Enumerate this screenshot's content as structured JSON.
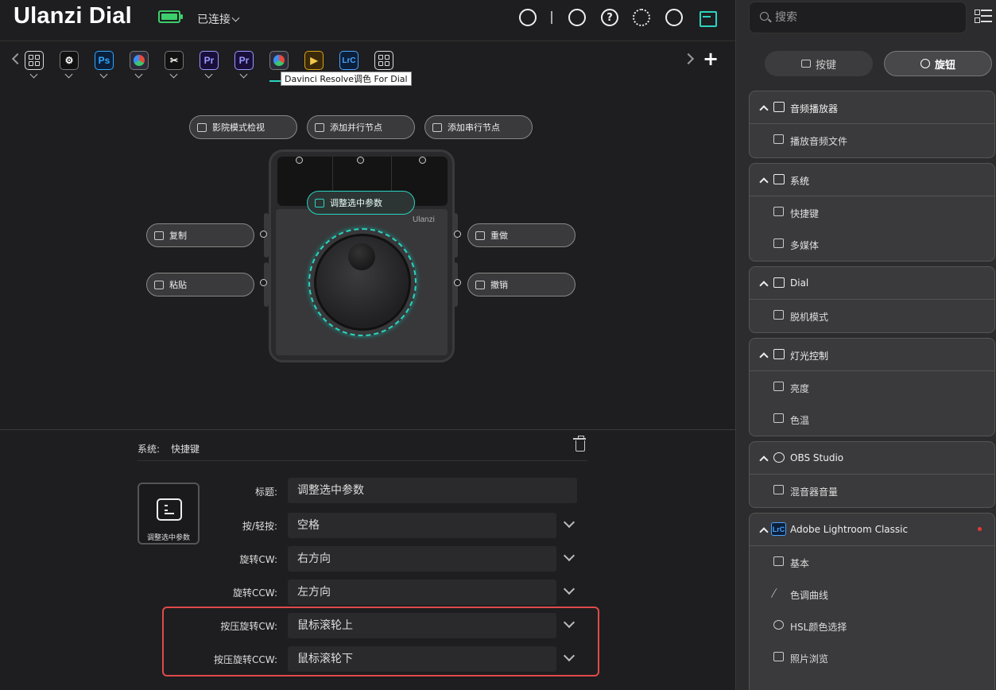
{
  "header": {
    "title": "Ulanzi Dial",
    "connection_status": "已连接",
    "battery_level": 1.0,
    "icons": [
      "u-logo-icon",
      "palette-icon",
      "help-icon",
      "settings-icon",
      "account-icon",
      "store-icon"
    ]
  },
  "toolbar": {
    "profiles": [
      {
        "name": "grid",
        "label": ""
      },
      {
        "name": "settings-app",
        "label": ""
      },
      {
        "name": "photoshop",
        "label": "Ps"
      },
      {
        "name": "davinci-resolve",
        "label": ""
      },
      {
        "name": "capcut",
        "label": ""
      },
      {
        "name": "premiere-pro-1",
        "label": "Pr"
      },
      {
        "name": "premiere-pro-2",
        "label": "Pr"
      },
      {
        "name": "davinci-resolve-active",
        "label": ""
      },
      {
        "name": "final-cut",
        "label": ""
      },
      {
        "name": "lightroom-classic",
        "label": "LrC"
      },
      {
        "name": "grid-2",
        "label": ""
      }
    ],
    "tooltip": "Davinci Resolve调色 For Dial",
    "add_symbol": "+"
  },
  "canvas": {
    "top_buttons": [
      "影院模式检视",
      "添加并行节点",
      "添加串行节点"
    ],
    "center_button": "调整选中参数",
    "left_buttons": [
      "复制",
      "粘贴"
    ],
    "right_buttons": [
      "重做",
      "撤销"
    ],
    "brand": "Ulanzi"
  },
  "properties": {
    "category": "系统:",
    "action": "快捷键",
    "preview_label": "调整选中参数",
    "fields": [
      {
        "label": "标题:",
        "value": "调整选中参数",
        "has_dropdown": false
      },
      {
        "label": "按/轻按:",
        "value": "空格",
        "has_dropdown": true
      },
      {
        "label": "旋转CW:",
        "value": "右方向",
        "has_dropdown": true
      },
      {
        "label": "旋转CCW:",
        "value": "左方向",
        "has_dropdown": true
      },
      {
        "label": "按压旋转CW:",
        "value": "鼠标滚轮上",
        "has_dropdown": true
      },
      {
        "label": "按压旋转CCW:",
        "value": "鼠标滚轮下",
        "has_dropdown": true
      }
    ]
  },
  "sidebar": {
    "search_placeholder": "搜索",
    "tabs": [
      {
        "label": "按键",
        "active": false
      },
      {
        "label": "旋钮",
        "active": true
      }
    ],
    "groups": [
      {
        "title": "音频播放器",
        "items": [
          "播放音频文件"
        ]
      },
      {
        "title": "系统",
        "items": [
          "快捷键",
          "多媒体"
        ]
      },
      {
        "title": "Dial",
        "items": [
          "脱机模式"
        ]
      },
      {
        "title": "灯光控制",
        "items": [
          "亮度",
          "色温"
        ]
      },
      {
        "title": "OBS Studio",
        "items": [
          "混音器音量"
        ]
      },
      {
        "title": "Adobe Lightroom Classic",
        "badge": "LrC",
        "items": [
          "基本",
          "色调曲线",
          "HSL颜色选择",
          "照片浏览"
        ]
      }
    ]
  },
  "colors": {
    "accent": "#2ad4c0",
    "battery": "#3ccf6c",
    "highlight": "#e04a4a"
  }
}
